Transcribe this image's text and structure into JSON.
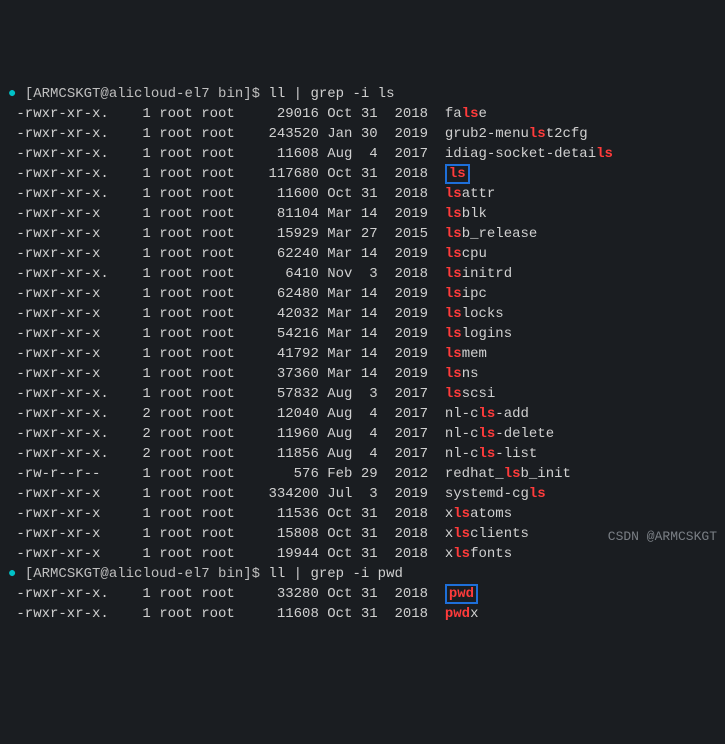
{
  "prompt_dot": "●",
  "prompts": [
    {
      "user_host": "[ARMCSKGT@alicloud-el7 bin]$ ",
      "command": "ll | grep -i ls"
    },
    {
      "user_host": "[ARMCSKGT@alicloud-el7 bin]$ ",
      "command": "ll | grep -i pwd"
    }
  ],
  "watermark": "CSDN @ARMCSKGT",
  "rows": [
    {
      "perm": "-rwxr-xr-x.",
      "links": "1",
      "owner": "root",
      "group": "root",
      "size": "29016",
      "month": "Oct",
      "day": "31",
      "yeartime": "2018",
      "pre": "fa",
      "hl": "ls",
      "post": "e",
      "boxed": false
    },
    {
      "perm": "-rwxr-xr-x.",
      "links": "1",
      "owner": "root",
      "group": "root",
      "size": "243520",
      "month": "Jan",
      "day": "30",
      "yeartime": "2019",
      "pre": "grub2-menu",
      "hl": "ls",
      "post": "t2cfg",
      "boxed": false
    },
    {
      "perm": "-rwxr-xr-x.",
      "links": "1",
      "owner": "root",
      "group": "root",
      "size": "11608",
      "month": "Aug",
      "day": "4",
      "yeartime": "2017",
      "pre": "idiag-socket-detai",
      "hl": "ls",
      "post": "",
      "boxed": false
    },
    {
      "perm": "-rwxr-xr-x.",
      "links": "1",
      "owner": "root",
      "group": "root",
      "size": "117680",
      "month": "Oct",
      "day": "31",
      "yeartime": "2018",
      "pre": "",
      "hl": "ls",
      "post": "",
      "boxed": true
    },
    {
      "perm": "-rwxr-xr-x.",
      "links": "1",
      "owner": "root",
      "group": "root",
      "size": "11600",
      "month": "Oct",
      "day": "31",
      "yeartime": "2018",
      "pre": "",
      "hl": "ls",
      "post": "attr",
      "boxed": false
    },
    {
      "perm": "-rwxr-xr-x",
      "links": "1",
      "owner": "root",
      "group": "root",
      "size": "81104",
      "month": "Mar",
      "day": "14",
      "yeartime": "2019",
      "pre": "",
      "hl": "ls",
      "post": "blk",
      "boxed": false
    },
    {
      "perm": "-rwxr-xr-x",
      "links": "1",
      "owner": "root",
      "group": "root",
      "size": "15929",
      "month": "Mar",
      "day": "27",
      "yeartime": "2015",
      "pre": "",
      "hl": "ls",
      "post": "b_release",
      "boxed": false
    },
    {
      "perm": "-rwxr-xr-x",
      "links": "1",
      "owner": "root",
      "group": "root",
      "size": "62240",
      "month": "Mar",
      "day": "14",
      "yeartime": "2019",
      "pre": "",
      "hl": "ls",
      "post": "cpu",
      "boxed": false
    },
    {
      "perm": "-rwxr-xr-x.",
      "links": "1",
      "owner": "root",
      "group": "root",
      "size": "6410",
      "month": "Nov",
      "day": "3",
      "yeartime": "2018",
      "pre": "",
      "hl": "ls",
      "post": "initrd",
      "boxed": false
    },
    {
      "perm": "-rwxr-xr-x",
      "links": "1",
      "owner": "root",
      "group": "root",
      "size": "62480",
      "month": "Mar",
      "day": "14",
      "yeartime": "2019",
      "pre": "",
      "hl": "ls",
      "post": "ipc",
      "boxed": false
    },
    {
      "perm": "-rwxr-xr-x",
      "links": "1",
      "owner": "root",
      "group": "root",
      "size": "42032",
      "month": "Mar",
      "day": "14",
      "yeartime": "2019",
      "pre": "",
      "hl": "ls",
      "post": "locks",
      "boxed": false
    },
    {
      "perm": "-rwxr-xr-x",
      "links": "1",
      "owner": "root",
      "group": "root",
      "size": "54216",
      "month": "Mar",
      "day": "14",
      "yeartime": "2019",
      "pre": "",
      "hl": "ls",
      "post": "logins",
      "boxed": false
    },
    {
      "perm": "-rwxr-xr-x",
      "links": "1",
      "owner": "root",
      "group": "root",
      "size": "41792",
      "month": "Mar",
      "day": "14",
      "yeartime": "2019",
      "pre": "",
      "hl": "ls",
      "post": "mem",
      "boxed": false
    },
    {
      "perm": "-rwxr-xr-x",
      "links": "1",
      "owner": "root",
      "group": "root",
      "size": "37360",
      "month": "Mar",
      "day": "14",
      "yeartime": "2019",
      "pre": "",
      "hl": "ls",
      "post": "ns",
      "boxed": false
    },
    {
      "perm": "-rwxr-xr-x.",
      "links": "1",
      "owner": "root",
      "group": "root",
      "size": "57832",
      "month": "Aug",
      "day": "3",
      "yeartime": "2017",
      "pre": "",
      "hl": "ls",
      "post": "scsi",
      "boxed": false
    },
    {
      "perm": "-rwxr-xr-x.",
      "links": "2",
      "owner": "root",
      "group": "root",
      "size": "12040",
      "month": "Aug",
      "day": "4",
      "yeartime": "2017",
      "pre": "nl-c",
      "hl": "ls",
      "post": "-add",
      "boxed": false
    },
    {
      "perm": "-rwxr-xr-x.",
      "links": "2",
      "owner": "root",
      "group": "root",
      "size": "11960",
      "month": "Aug",
      "day": "4",
      "yeartime": "2017",
      "pre": "nl-c",
      "hl": "ls",
      "post": "-delete",
      "boxed": false
    },
    {
      "perm": "-rwxr-xr-x.",
      "links": "2",
      "owner": "root",
      "group": "root",
      "size": "11856",
      "month": "Aug",
      "day": "4",
      "yeartime": "2017",
      "pre": "nl-c",
      "hl": "ls",
      "post": "-list",
      "boxed": false
    },
    {
      "perm": "-rw-r--r--",
      "links": "1",
      "owner": "root",
      "group": "root",
      "size": "576",
      "month": "Feb",
      "day": "29",
      "yeartime": "2012",
      "pre": "redhat_",
      "hl": "ls",
      "post": "b_init",
      "boxed": false
    },
    {
      "perm": "-rwxr-xr-x",
      "links": "1",
      "owner": "root",
      "group": "root",
      "size": "334200",
      "month": "Jul",
      "day": "3",
      "yeartime": "2019",
      "pre": "systemd-cg",
      "hl": "ls",
      "post": "",
      "boxed": false
    },
    {
      "perm": "-rwxr-xr-x",
      "links": "1",
      "owner": "root",
      "group": "root",
      "size": "11536",
      "month": "Oct",
      "day": "31",
      "yeartime": "2018",
      "pre": "x",
      "hl": "ls",
      "post": "atoms",
      "boxed": false
    },
    {
      "perm": "-rwxr-xr-x",
      "links": "1",
      "owner": "root",
      "group": "root",
      "size": "15808",
      "month": "Oct",
      "day": "31",
      "yeartime": "2018",
      "pre": "x",
      "hl": "ls",
      "post": "clients",
      "boxed": false
    },
    {
      "perm": "-rwxr-xr-x",
      "links": "1",
      "owner": "root",
      "group": "root",
      "size": "19944",
      "month": "Oct",
      "day": "31",
      "yeartime": "2018",
      "pre": "x",
      "hl": "ls",
      "post": "fonts",
      "boxed": false
    }
  ],
  "rows2": [
    {
      "perm": "-rwxr-xr-x.",
      "links": "1",
      "owner": "root",
      "group": "root",
      "size": "33280",
      "month": "Oct",
      "day": "31",
      "yeartime": "2018",
      "pre": "",
      "hl": "pwd",
      "post": "",
      "boxed": true
    },
    {
      "perm": "-rwxr-xr-x.",
      "links": "1",
      "owner": "root",
      "group": "root",
      "size": "11608",
      "month": "Oct",
      "day": "31",
      "yeartime": "2018",
      "pre": "",
      "hl": "pwd",
      "post": "x",
      "boxed": false
    }
  ]
}
